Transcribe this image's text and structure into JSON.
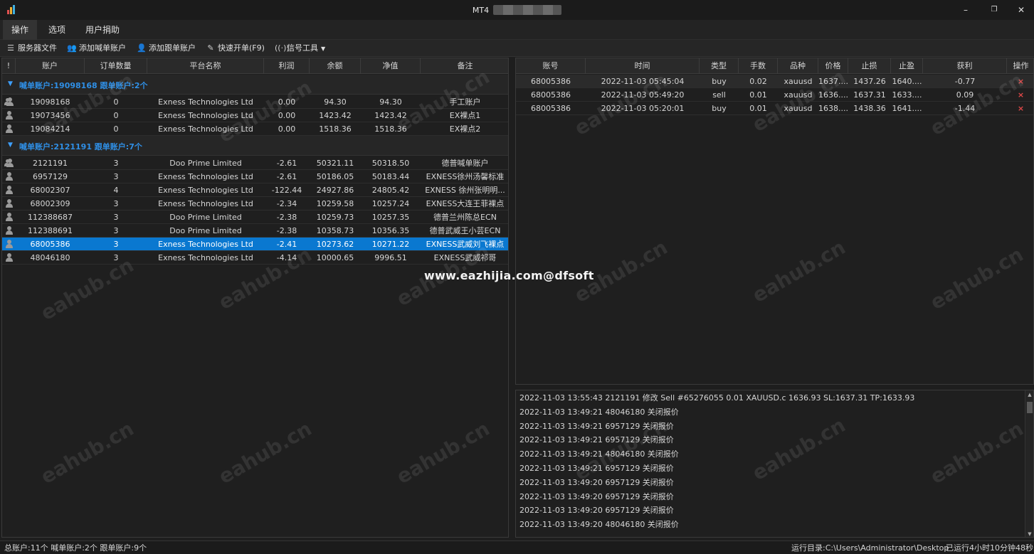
{
  "window": {
    "title": "MT4",
    "min_symbol": "–",
    "restore_symbol": "❐",
    "close_symbol": "✕"
  },
  "menu": [
    {
      "label": "操作",
      "active": true
    },
    {
      "label": "选项",
      "active": false
    },
    {
      "label": "用户捐助",
      "active": false
    }
  ],
  "toolbar": {
    "server_file": "服务器文件",
    "add_master": "添加喊单账户",
    "add_follower": "添加跟单账户",
    "quick_order": "快速开单(F9)",
    "signal_tools": "信号工具"
  },
  "accounts": {
    "headers": [
      "!",
      "账户",
      "订单数量",
      "平台名称",
      "利润",
      "余额",
      "净值",
      "备注"
    ],
    "groups": [
      {
        "label": "喊单账户:19098168 跟单账户:2个",
        "rows": [
          {
            "icon": "multi",
            "account": "19098168",
            "orders": "0",
            "platform": "Exness Technologies Ltd",
            "profit": "0.00",
            "balance": "94.30",
            "equity": "94.30",
            "note": "手工账户"
          },
          {
            "icon": "single",
            "account": "19073456",
            "orders": "0",
            "platform": "Exness Technologies Ltd",
            "profit": "0.00",
            "balance": "1423.42",
            "equity": "1423.42",
            "note": "EX裸点1"
          },
          {
            "icon": "single",
            "account": "19084214",
            "orders": "0",
            "platform": "Exness Technologies Ltd",
            "profit": "0.00",
            "balance": "1518.36",
            "equity": "1518.36",
            "note": "EX裸点2"
          }
        ]
      },
      {
        "label": "喊单账户:2121191 跟单账户:7个",
        "rows": [
          {
            "icon": "multi",
            "account": "2121191",
            "orders": "3",
            "platform": "Doo Prime Limited",
            "profit": "-2.61",
            "balance": "50321.11",
            "equity": "50318.50",
            "note": "德普喊单账户"
          },
          {
            "icon": "single",
            "account": "6957129",
            "orders": "3",
            "platform": "Exness Technologies Ltd",
            "profit": "-2.61",
            "balance": "50186.05",
            "equity": "50183.44",
            "note": "EXNESS徐州汤馨标准"
          },
          {
            "icon": "single",
            "account": "68002307",
            "orders": "4",
            "platform": "Exness Technologies Ltd",
            "profit": "-122.44",
            "balance": "24927.86",
            "equity": "24805.42",
            "note": "EXNESS 徐州张明明..."
          },
          {
            "icon": "single",
            "account": "68002309",
            "orders": "3",
            "platform": "Exness Technologies Ltd",
            "profit": "-2.34",
            "balance": "10259.58",
            "equity": "10257.24",
            "note": "EXNESS大连王菲裸点"
          },
          {
            "icon": "single",
            "account": "112388687",
            "orders": "3",
            "platform": "Doo Prime Limited",
            "profit": "-2.38",
            "balance": "10259.73",
            "equity": "10257.35",
            "note": "德普兰州陈总ECN"
          },
          {
            "icon": "single",
            "account": "112388691",
            "orders": "3",
            "platform": "Doo Prime Limited",
            "profit": "-2.38",
            "balance": "10358.73",
            "equity": "10356.35",
            "note": "德普武威王小芸ECN"
          },
          {
            "icon": "single",
            "account": "68005386",
            "orders": "3",
            "platform": "Exness Technologies Ltd",
            "profit": "-2.41",
            "balance": "10273.62",
            "equity": "10271.22",
            "note": "EXNESS武威刘飞裸点",
            "selected": true
          },
          {
            "icon": "single",
            "account": "48046180",
            "orders": "3",
            "platform": "Exness Technologies Ltd",
            "profit": "-4.14",
            "balance": "10000.65",
            "equity": "9996.51",
            "note": "EXNESS武威祁哥"
          }
        ]
      }
    ]
  },
  "orders": {
    "headers": [
      "账号",
      "时间",
      "类型",
      "手数",
      "品种",
      "价格",
      "止损",
      "止盈",
      "获利",
      "操作"
    ],
    "rows": [
      {
        "account": "68005386",
        "time": "2022-11-03 05:45:04",
        "type": "buy",
        "lots": "0.02",
        "symbol": "xauusd",
        "price": "1637....",
        "sl": "1437.26",
        "tp": "1640....",
        "profit": "-0.77",
        "action": "×"
      },
      {
        "account": "68005386",
        "time": "2022-11-03 05:49:20",
        "type": "sell",
        "lots": "0.01",
        "symbol": "xauusd",
        "price": "1636....",
        "sl": "1637.31",
        "tp": "1633....",
        "profit": "0.09",
        "action": "×"
      },
      {
        "account": "68005386",
        "time": "2022-11-03 05:20:01",
        "type": "buy",
        "lots": "0.01",
        "symbol": "xauusd",
        "price": "1638....",
        "sl": "1438.36",
        "tp": "1641....",
        "profit": "-1.44",
        "action": "×"
      }
    ]
  },
  "log": [
    "2022-11-03 13:55:43 2121191 修改 Sell #65276055 0.01 XAUUSD.c 1636.93 SL:1637.31 TP:1633.93",
    "2022-11-03 13:49:21 48046180 关闭报价",
    "2022-11-03 13:49:21 6957129 关闭报价",
    "2022-11-03 13:49:21 6957129 关闭报价",
    "2022-11-03 13:49:21 48046180 关闭报价",
    "2022-11-03 13:49:21 6957129 关闭报价",
    "2022-11-03 13:49:20 6957129 关闭报价",
    "2022-11-03 13:49:20 6957129 关闭报价",
    "2022-11-03 13:49:20 6957129 关闭报价",
    "2022-11-03 13:49:20 48046180 关闭报价"
  ],
  "status": {
    "left": "总账户:11个 喊单账户:2个 跟单账户:9个",
    "directory": "运行目录:C:\\Users\\Administrator\\Desktop",
    "uptime": "已运行4小时10分钟48秒"
  },
  "watermark": "eahub.cn",
  "url_watermark": "www.eazhijia.com@dfsoft",
  "colors": {
    "accent": "#2f8fe6",
    "selected": "#0a78d0",
    "close": "#e04848"
  }
}
